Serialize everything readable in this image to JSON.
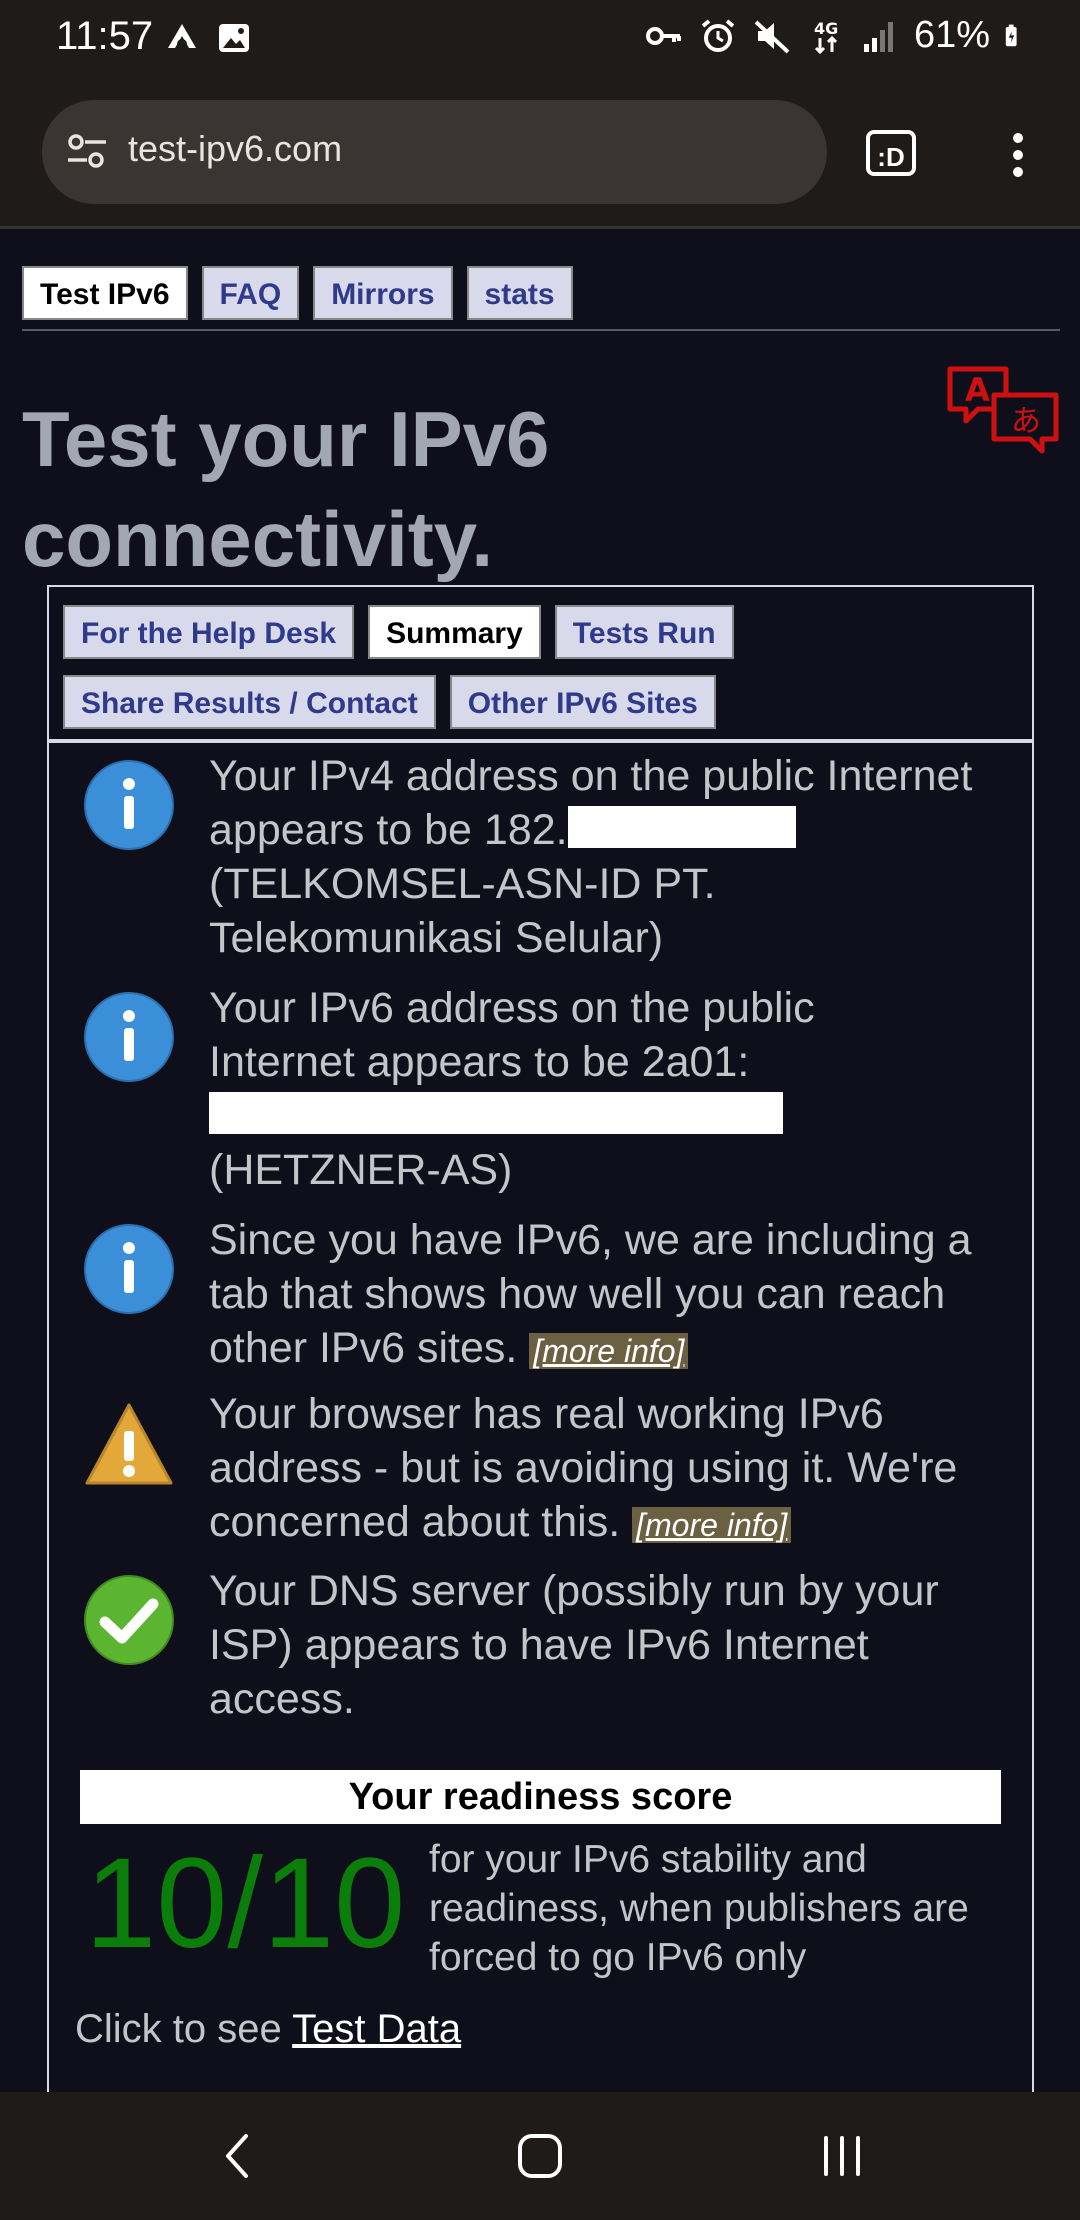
{
  "status_bar": {
    "time": "11:57",
    "battery": "61%",
    "icons_left": [
      "android-auto-icon",
      "image-icon"
    ],
    "icons_right": [
      "key-icon",
      "alarm-icon",
      "mute-icon",
      "4g-icon",
      "signal-icon",
      "battery-icon"
    ]
  },
  "browser": {
    "url": "test-ipv6.com",
    "ext_label": ":D"
  },
  "top_tabs": [
    "Test IPv6",
    "FAQ",
    "Mirrors",
    "stats"
  ],
  "title": "Test your IPv6 connectivity.",
  "inner_tabs": {
    "row1": [
      "For the Help Desk",
      "Summary",
      "Tests Run"
    ],
    "row2": [
      "Share Results / Contact",
      "Other IPv6 Sites"
    ]
  },
  "messages": [
    {
      "icon": "info-icon",
      "line1": "Your IPv4 address on the public Internet appears to be 182.",
      "line2": "(TELKOMSEL-ASN-ID PT. Telekomunikasi Selular)"
    },
    {
      "icon": "info-icon",
      "line1": "Your IPv6 address on the public Internet appears to be 2a01:",
      "line2": "(HETZNER-AS)"
    },
    {
      "icon": "info-icon",
      "text": "Since you have IPv6, we are including a tab that shows how well you can reach other IPv6 sites.",
      "link": "[more info]"
    },
    {
      "icon": "warning-icon",
      "text": "Your browser has real working IPv6 address - but is avoiding using it. We're concerned about this.",
      "link": "[more info]"
    },
    {
      "icon": "check-icon",
      "text": "Your DNS server (possibly run by your ISP) appears to have IPv6 Internet access."
    }
  ],
  "score": {
    "header": "Your readiness score",
    "value": "10/10",
    "description": "for your IPv6 stability and readiness, when publishers are forced to go IPv6 only"
  },
  "footer": {
    "prefix": "Click to see ",
    "link": "Test Data"
  },
  "colors": {
    "page_bg": "#0e0f1a",
    "tab_bg": "#d9d9ec",
    "tab_text": "#2f3a8a",
    "score_green": "#0a7d0a",
    "info_blue": "#3a8fd8",
    "warning_yellow": "#e2a93a",
    "check_green": "#5cb531"
  }
}
